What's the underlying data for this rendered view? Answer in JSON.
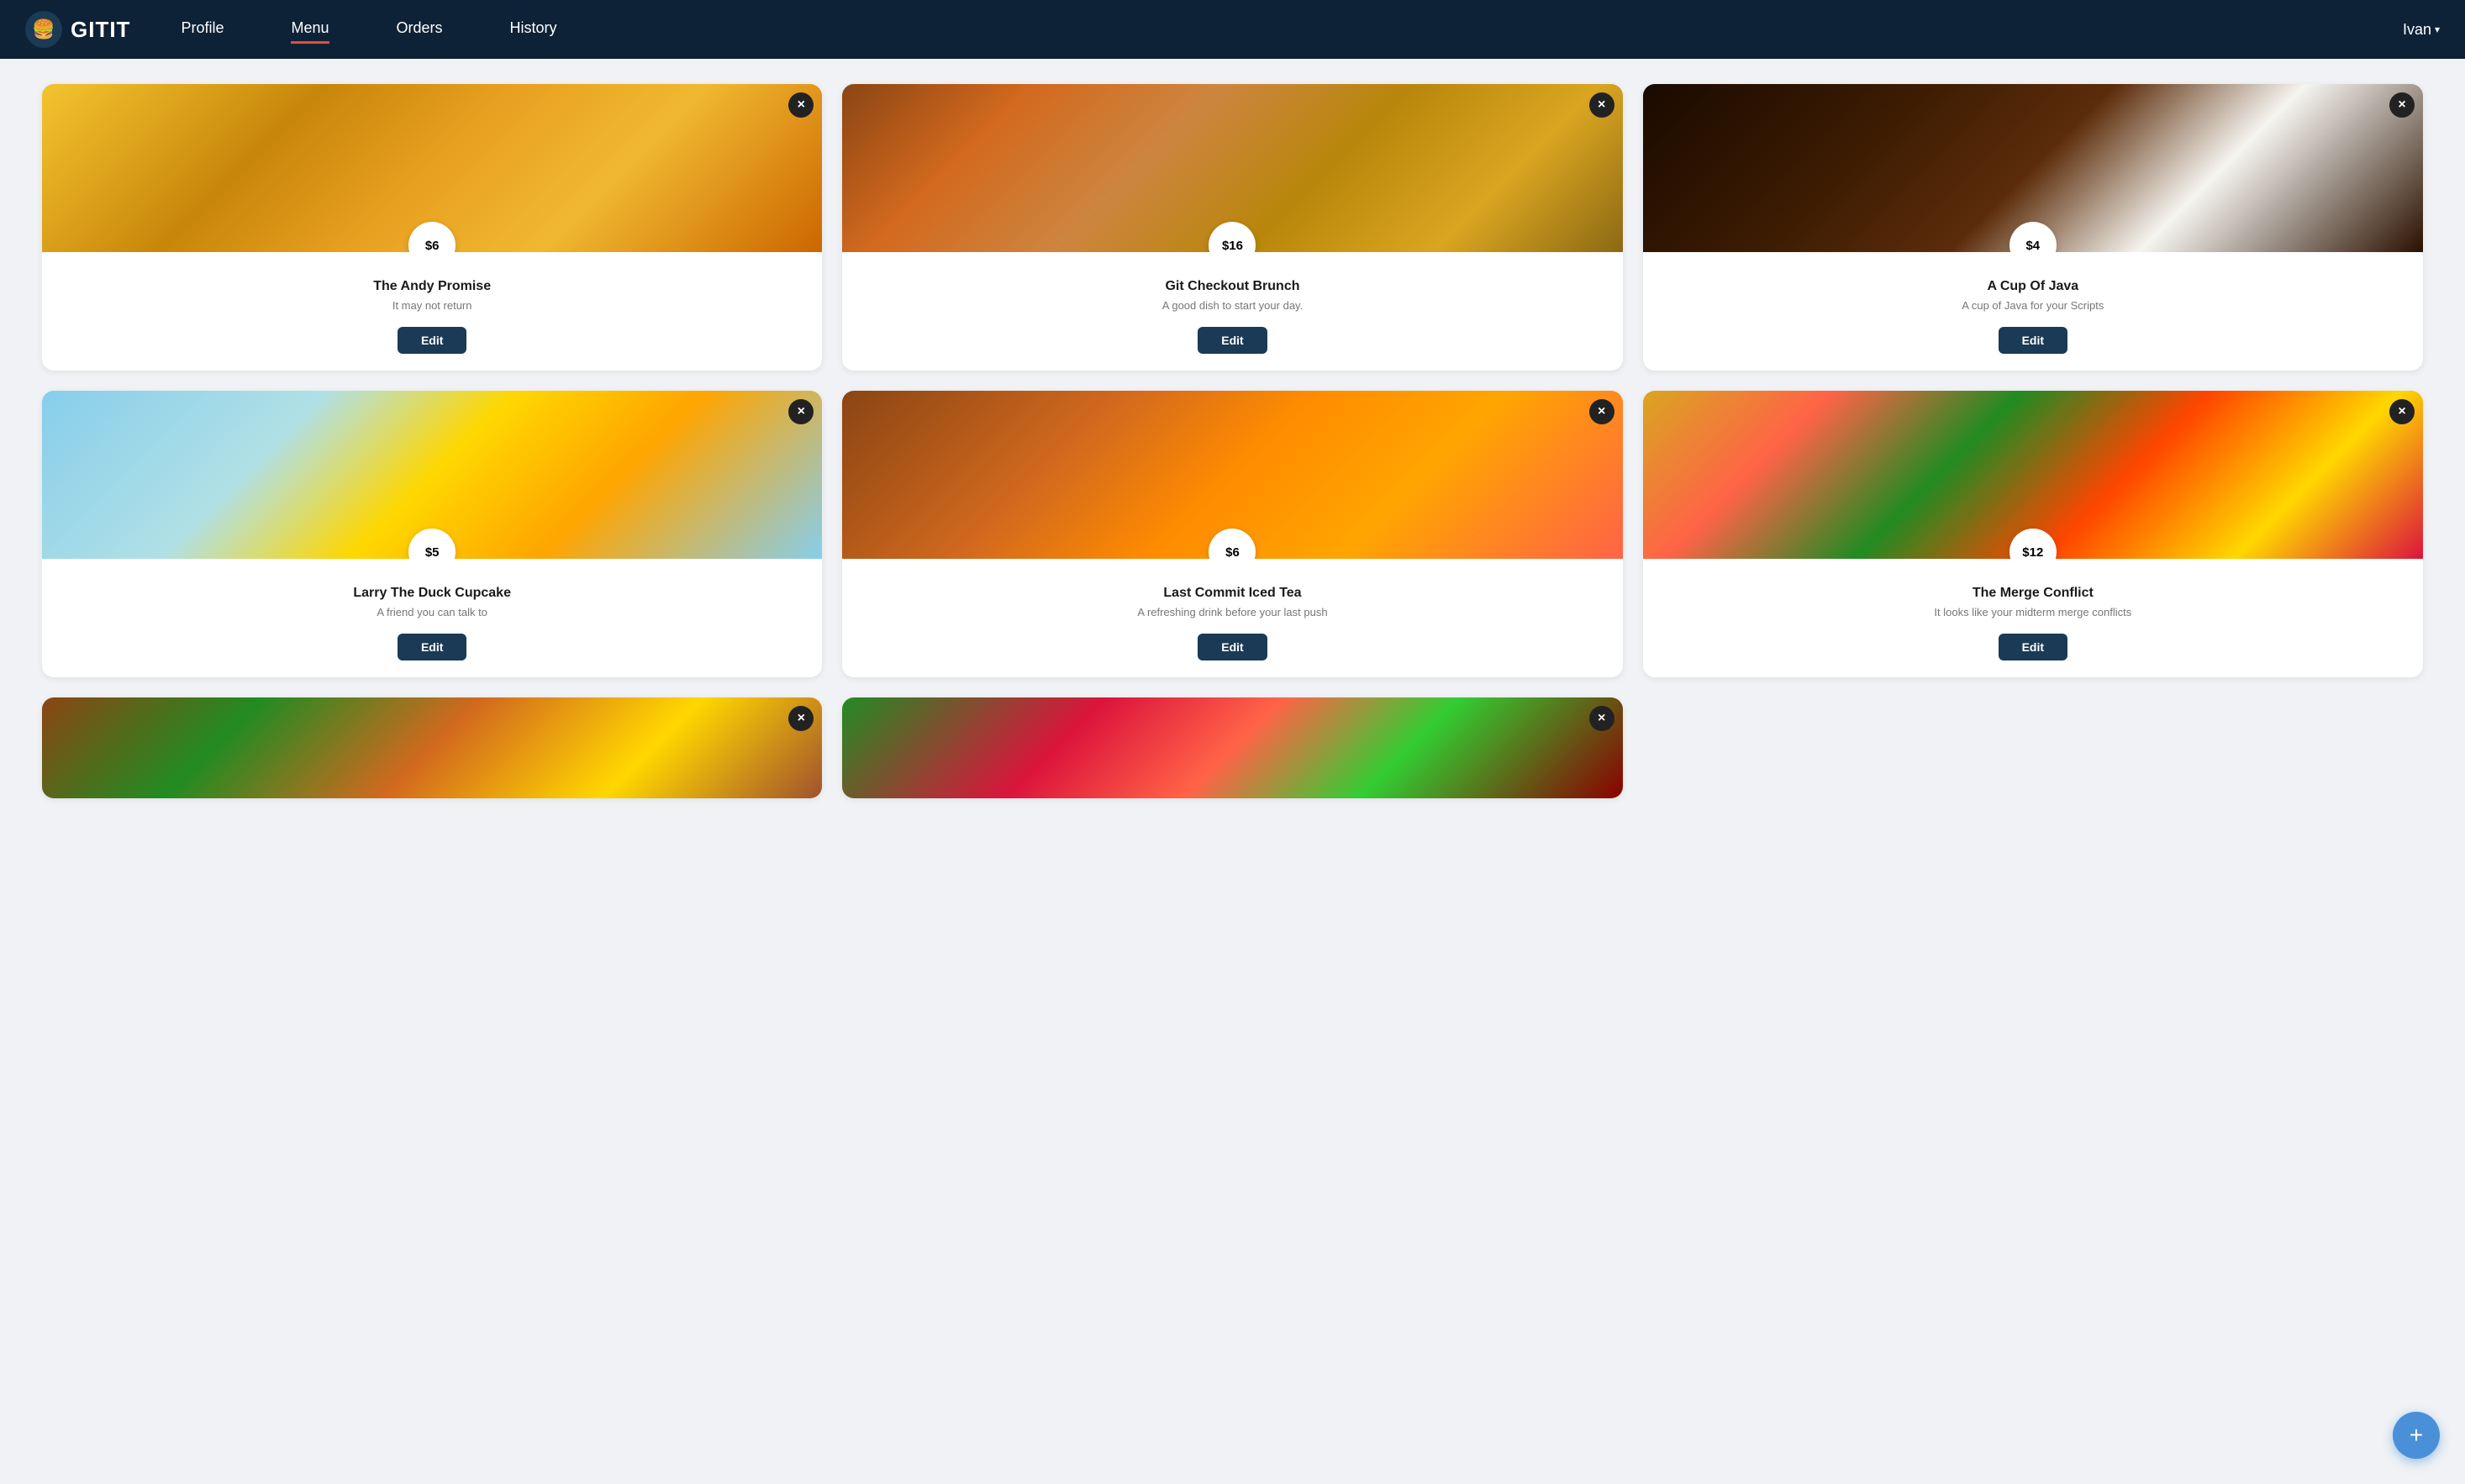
{
  "brand": {
    "icon": "🍔",
    "name": "GITIT"
  },
  "nav": {
    "links": [
      {
        "id": "profile",
        "label": "Profile",
        "active": false
      },
      {
        "id": "menu",
        "label": "Menu",
        "active": true
      },
      {
        "id": "orders",
        "label": "Orders",
        "active": false
      },
      {
        "id": "history",
        "label": "History",
        "active": false
      }
    ],
    "user": {
      "name": "Ivan",
      "chevron": "▾"
    }
  },
  "cards": [
    {
      "id": "andy-promise",
      "title": "The Andy Promise",
      "description": "It may not return",
      "price": "$6",
      "edit_label": "Edit",
      "image_class": "img-fries",
      "close_label": "×"
    },
    {
      "id": "git-checkout-brunch",
      "title": "Git Checkout Brunch",
      "description": "A good dish to start your day.",
      "price": "$16",
      "edit_label": "Edit",
      "image_class": "img-brunch",
      "close_label": "×"
    },
    {
      "id": "cup-of-java",
      "title": "A Cup Of Java",
      "description": "A cup of Java for your Scripts",
      "price": "$4",
      "edit_label": "Edit",
      "image_class": "img-coffee",
      "close_label": "×"
    },
    {
      "id": "larry-duck-cupcake",
      "title": "Larry The Duck Cupcake",
      "description": "A friend you can talk to",
      "price": "$5",
      "edit_label": "Edit",
      "image_class": "img-cupcake",
      "close_label": "×"
    },
    {
      "id": "last-commit-iced-tea",
      "title": "Last Commit Iced Tea",
      "description": "A refreshing drink before your last push",
      "price": "$6",
      "edit_label": "Edit",
      "image_class": "img-icedtea",
      "close_label": "×"
    },
    {
      "id": "merge-conflict",
      "title": "The Merge Conflict",
      "description": "It looks like your midterm merge conflicts",
      "price": "$12",
      "edit_label": "Edit",
      "image_class": "img-pizza",
      "close_label": "×"
    }
  ],
  "partial_cards": [
    {
      "id": "burger",
      "image_class": "img-burger",
      "close_label": "×"
    },
    {
      "id": "salad",
      "image_class": "img-salad",
      "close_label": "×"
    }
  ],
  "fab": {
    "label": "+"
  }
}
